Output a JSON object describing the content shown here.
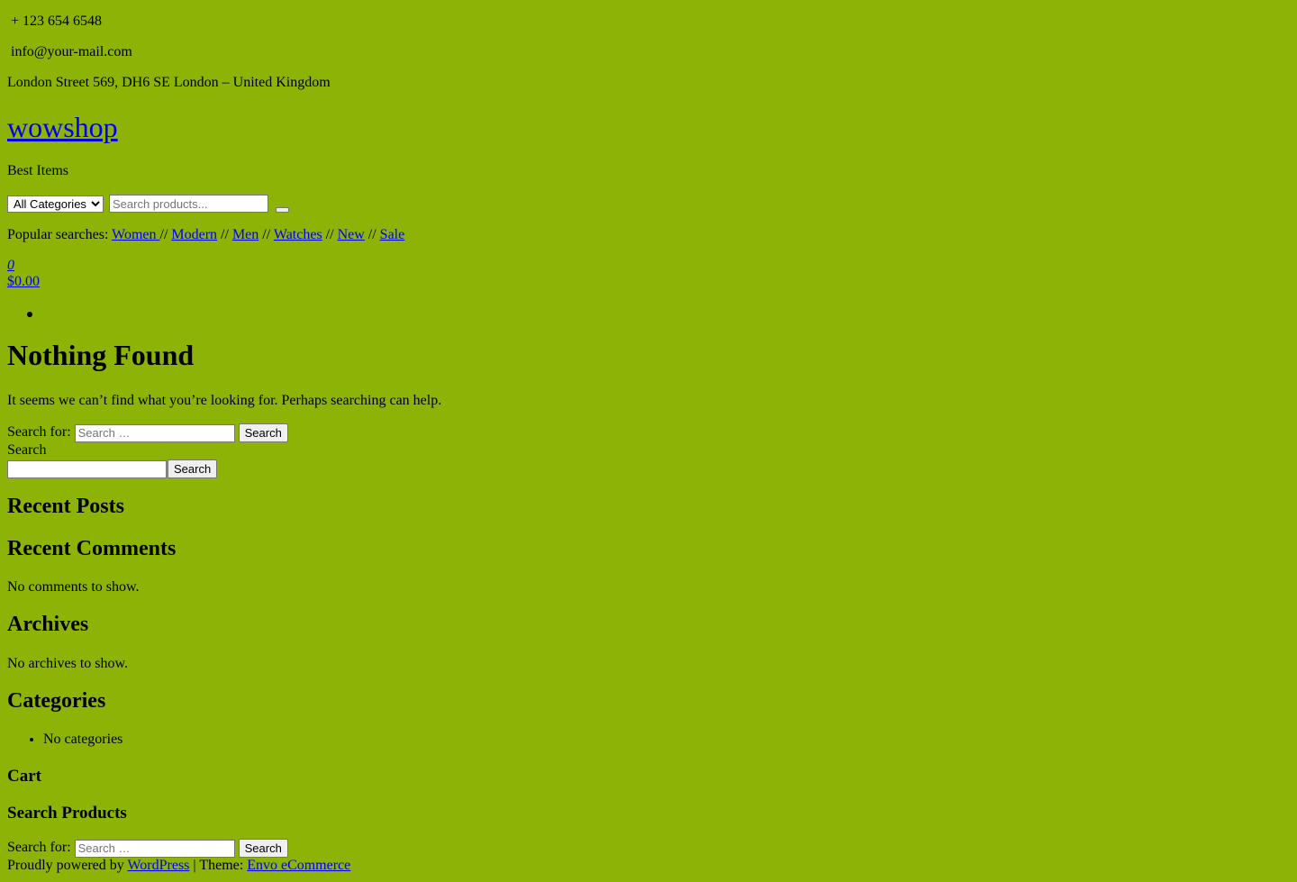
{
  "topbar": {
    "phone": "+ 123 654 6548",
    "email": "info@your-mail.com",
    "address": "London Street 569, DH6 SE London – United Kingdom"
  },
  "site": {
    "title": "wowshop",
    "tagline": "Best Items"
  },
  "product_search": {
    "category_selected": "All Categories",
    "placeholder": "Search products..."
  },
  "popular": {
    "label": "Popular searches: ",
    "separator": "//",
    "links": [
      "Women ",
      "Modern",
      "Men",
      "Watches",
      "New",
      "Sale"
    ]
  },
  "cart": {
    "count": "0",
    "total": "$0.00"
  },
  "main": {
    "title": "Nothing Found",
    "message": "It seems we can’t find what you’re looking for. Perhaps searching can help.",
    "search_label": "Search for:",
    "search_placeholder": "Search …",
    "search_button": "Search"
  },
  "sidebar": {
    "search_label": "Search",
    "search_button": "Search",
    "recent_posts_title": "Recent Posts",
    "recent_comments_title": "Recent Comments",
    "no_comments": "No comments to show.",
    "archives_title": "Archives",
    "no_archives": "No archives to show.",
    "categories_title": "Categories",
    "no_categories": "No categories",
    "cart_title": "Cart",
    "search_products_title": "Search Products",
    "sp_label": "Search for:",
    "sp_placeholder": "Search …",
    "sp_button": "Search"
  },
  "footer": {
    "powered": "Proudly powered by ",
    "wordpress": "WordPress",
    "theme_sep": " | Theme: ",
    "theme_link": "Envo eCommerce"
  }
}
